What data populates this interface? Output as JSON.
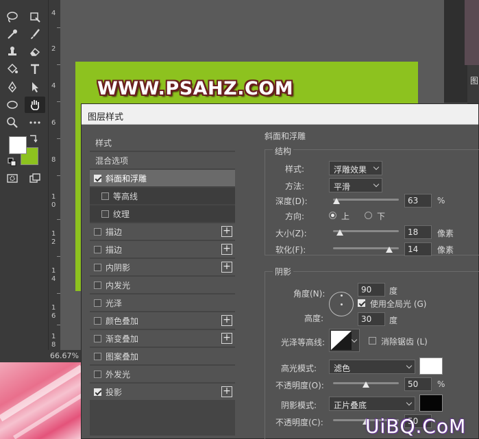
{
  "toolbar": {
    "colors": {
      "foreground": "#ffffff",
      "background": "#8dc21f"
    }
  },
  "ruler_labels": [
    "4",
    "2",
    "4",
    "6",
    "8",
    "1",
    "0",
    "1",
    "2",
    "1",
    "4",
    "1",
    "6",
    "1",
    "8"
  ],
  "canvas": {
    "document_text": "WWW.PSAHZ.COM",
    "zoom": "66.67%",
    "right_panel_tab": "图"
  },
  "dialog": {
    "title": "图层样式",
    "styles_list": [
      {
        "label": "样式",
        "type": "header"
      },
      {
        "label": "混合选项",
        "type": "header"
      },
      {
        "label": "斜面和浮雕",
        "type": "item",
        "checked": true,
        "selected": true
      },
      {
        "label": "等高线",
        "type": "sub",
        "checked": false
      },
      {
        "label": "纹理",
        "type": "sub",
        "checked": false
      },
      {
        "label": "描边",
        "type": "item",
        "checked": false,
        "plus": true
      },
      {
        "label": "描边",
        "type": "item",
        "checked": false,
        "plus": true
      },
      {
        "label": "内阴影",
        "type": "item",
        "checked": false,
        "plus": true
      },
      {
        "label": "内发光",
        "type": "item",
        "checked": false
      },
      {
        "label": "光泽",
        "type": "item",
        "checked": false
      },
      {
        "label": "颜色叠加",
        "type": "item",
        "checked": false,
        "plus": true
      },
      {
        "label": "渐变叠加",
        "type": "item",
        "checked": false,
        "plus": true
      },
      {
        "label": "图案叠加",
        "type": "item",
        "checked": false
      },
      {
        "label": "外发光",
        "type": "item",
        "checked": false
      },
      {
        "label": "投影",
        "type": "item",
        "checked": true,
        "plus": true
      }
    ],
    "bevel": {
      "section_title": "斜面和浮雕",
      "structure_title": "结构",
      "style_label": "样式:",
      "style_value": "浮雕效果",
      "technique_label": "方法:",
      "technique_value": "平滑",
      "depth_label": "深度(D):",
      "depth_value": "63",
      "depth_unit": "%",
      "depth_level": 0.05,
      "direction_label": "方向:",
      "direction_up": "上",
      "direction_down": "下",
      "direction_selected": "上",
      "size_label": "大小(Z):",
      "size_value": "18",
      "size_unit": "像素",
      "size_level": 0.1,
      "soften_label": "软化(F):",
      "soften_value": "14",
      "soften_unit": "像素",
      "soften_level": 0.85
    },
    "shading": {
      "title": "阴影",
      "angle_label": "角度(N):",
      "angle_value": "90",
      "angle_unit": "度",
      "global_light_label": "使用全局光 (G)",
      "global_light_checked": true,
      "altitude_label": "高度:",
      "altitude_value": "30",
      "altitude_unit": "度",
      "gloss_contour_label": "光泽等高线:",
      "anti_alias_label": "消除锯齿 (L)",
      "anti_alias_checked": false,
      "highlight_mode_label": "高光模式:",
      "highlight_mode_value": "滤色",
      "highlight_color": "#ffffff",
      "highlight_opacity_label": "不透明度(O):",
      "highlight_opacity_value": "50",
      "highlight_opacity_unit": "%",
      "highlight_opacity_level": 0.5,
      "shadow_mode_label": "阴影模式:",
      "shadow_mode_value": "正片叠底",
      "shadow_color": "#050505",
      "shadow_opacity_label": "不透明度(C):",
      "shadow_opacity_value": "50",
      "shadow_opacity_level": 0.5
    }
  },
  "watermark": "UiBQ.CoM"
}
